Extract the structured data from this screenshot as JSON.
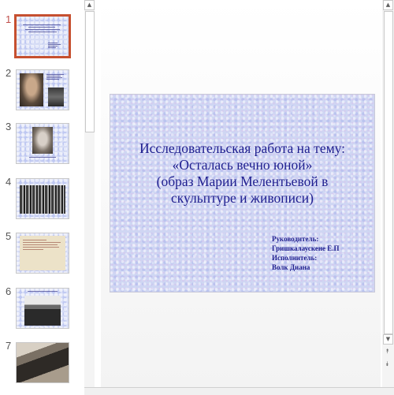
{
  "thumbnails": [
    {
      "number": "1",
      "selected": true
    },
    {
      "number": "2",
      "selected": false
    },
    {
      "number": "3",
      "selected": false
    },
    {
      "number": "4",
      "selected": false
    },
    {
      "number": "5",
      "selected": false
    },
    {
      "number": "6",
      "selected": false
    },
    {
      "number": "7",
      "selected": false
    }
  ],
  "slide": {
    "title_lines": [
      "Исследовательская работа на тему:",
      "«Осталась вечно юной»",
      "(образ Марии Мелентьевой в",
      "скульптуре и живописи)"
    ],
    "credit_lines": [
      "Руководитель:",
      "Гришкалаускене Е.П",
      "Исполнитель:",
      "Волк Диана"
    ]
  },
  "scrollbar_icons": {
    "up": "▲",
    "down": "▼",
    "prev_slide": "⯭",
    "next_slide": "⯯"
  },
  "colors": {
    "selected_border": "#c65030",
    "slide_text": "#1f1f8f",
    "slide_background": "#cfd6f3"
  }
}
